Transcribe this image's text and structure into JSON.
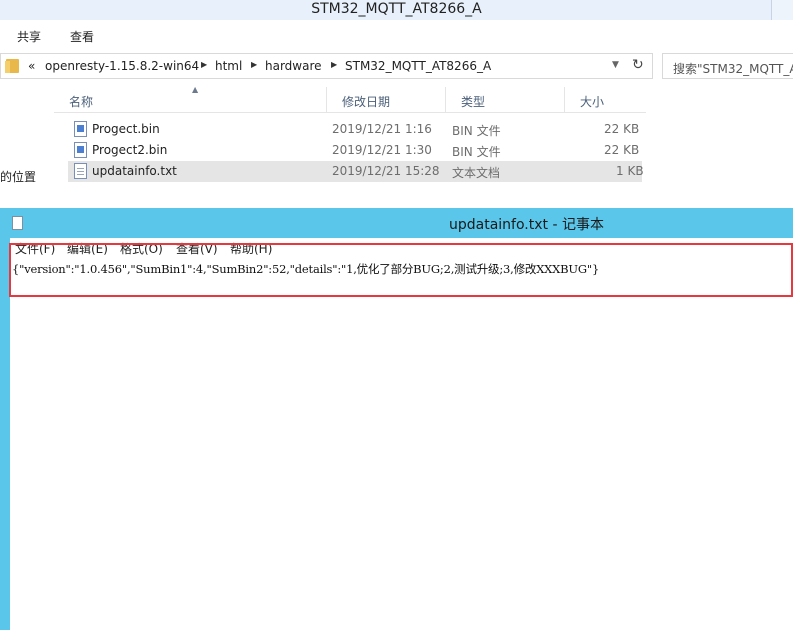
{
  "explorer": {
    "title": "STM32_MQTT_AT8266_A",
    "menu": [
      "共享",
      "查看"
    ],
    "breadcrumb": {
      "overflow": "«",
      "items": [
        "openresty-1.15.8.2-win64",
        "html",
        "hardware",
        "STM32_MQTT_AT8266_A"
      ]
    },
    "search_placeholder": "搜索\"STM32_MQTT_A",
    "columns": [
      "名称",
      "修改日期",
      "类型",
      "大小"
    ],
    "files": [
      {
        "name": "Progect.bin",
        "date": "2019/12/21 1:16",
        "type": "BIN 文件",
        "size": "22 KB",
        "icon": "bin-file-icon"
      },
      {
        "name": "Progect2.bin",
        "date": "2019/12/21 1:30",
        "type": "BIN 文件",
        "size": "22 KB",
        "icon": "bin-file-icon"
      },
      {
        "name": "updatainfo.txt",
        "date": "2019/12/21 15:28",
        "type": "文本文档",
        "size": "1 KB",
        "icon": "text-file-icon"
      }
    ],
    "side_label": "的位置"
  },
  "notepad": {
    "title": "updatainfo.txt - 记事本",
    "menu": [
      "文件(F)",
      "编辑(E)",
      "格式(O)",
      "查看(V)",
      "帮助(H)"
    ],
    "content": "{\"version\":\"1.0.456\",\"SumBin1\":4,\"SumBin2\":52,\"details\":\"1,优化了部分BUG;2,测试升级;3,修改XXXBUG\"}"
  },
  "colors": {
    "notepad_frame": "#5ac6ea",
    "highlight_border": "#e8383f",
    "selected_row": "#e5e5e5"
  }
}
